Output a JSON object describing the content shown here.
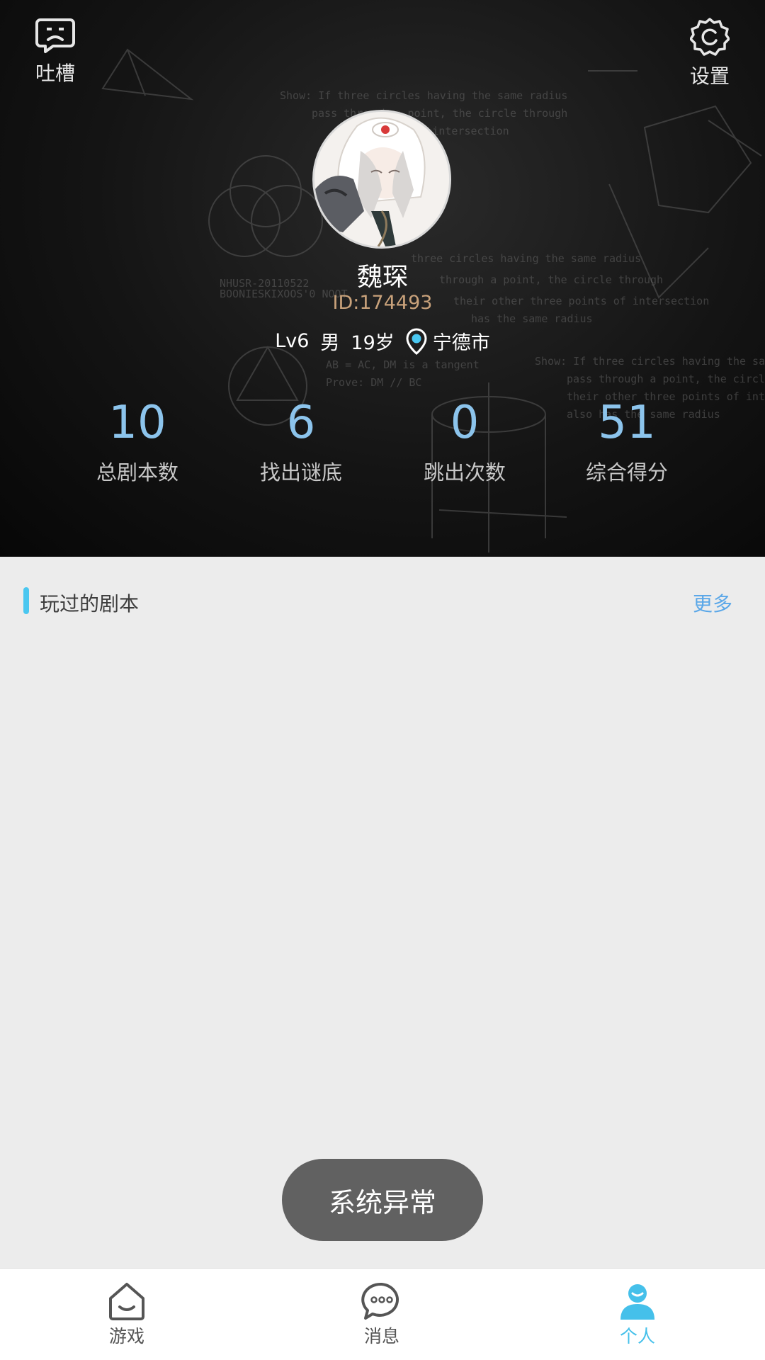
{
  "header": {
    "feedback_label": "吐槽",
    "settings_label": "设置",
    "username": "魏琛",
    "user_id": "ID:174493",
    "level": "Lv6",
    "gender": "男",
    "age": "19岁",
    "location": "宁德市"
  },
  "stats": [
    {
      "value": "10",
      "label": "总剧本数"
    },
    {
      "value": "6",
      "label": "找出谜底"
    },
    {
      "value": "0",
      "label": "跳出次数"
    },
    {
      "value": "51",
      "label": "综合得分"
    }
  ],
  "played": {
    "title": "玩过的剧本",
    "more_label": "更多"
  },
  "toast": {
    "message": "系统异常"
  },
  "nav": [
    {
      "label": "游戏",
      "icon": "home-smile-icon"
    },
    {
      "label": "消息",
      "icon": "chat-bubble-icon"
    },
    {
      "label": "个人",
      "icon": "person-icon"
    }
  ],
  "colors": {
    "accent": "#45c0ea",
    "stat_value": "#8cc4ec",
    "id_text": "#c9a27b",
    "more_link": "#5aa7e8",
    "page_bg": "#ececec"
  }
}
